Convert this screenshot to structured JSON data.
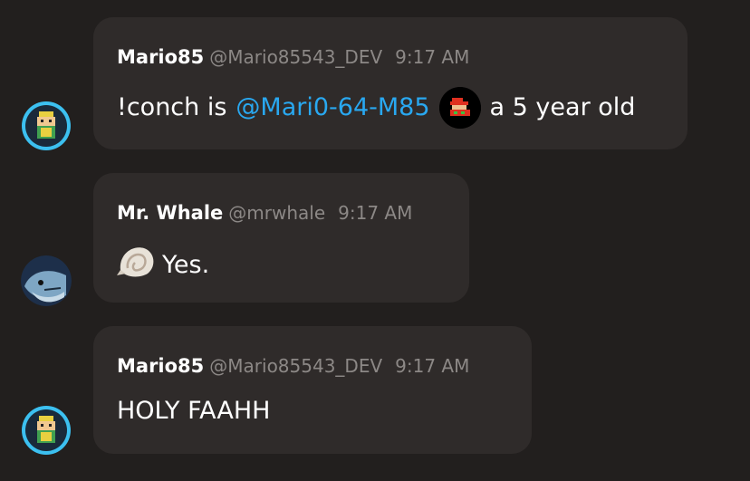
{
  "messages": [
    {
      "name": "Mario85",
      "handle": "@Mario85543_DEV",
      "time": "9:17 AM",
      "text_before": "!conch is",
      "mention": "@Mari0-64-M85",
      "text_after": "a 5 year old",
      "avatar_icon": "pixel-mario-icon",
      "inline_icon": "pixel-mario-emoji-icon"
    },
    {
      "name": "Mr. Whale",
      "handle": "@mrwhale",
      "time": "9:17 AM",
      "text": "Yes.",
      "avatar_icon": "whale-icon",
      "inline_icon": "spiral-shell-icon"
    },
    {
      "name": "Mario85",
      "handle": "@Mario85543_DEV",
      "time": "9:17 AM",
      "text": "HOLY FAAHH",
      "avatar_icon": "pixel-mario-icon"
    }
  ],
  "colors": {
    "background": "#221f1e",
    "bubble": "#2f2b2a",
    "mention": "#29a8f0",
    "meta_text": "#8c8886",
    "avatar_ring": "#3cc0f0"
  }
}
